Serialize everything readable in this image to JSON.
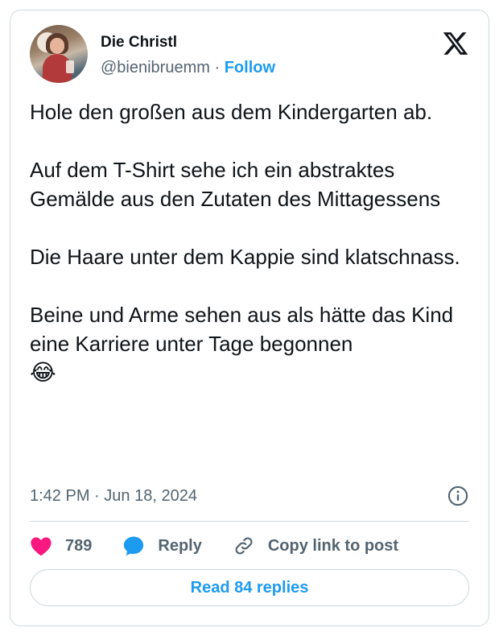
{
  "author": {
    "display_name": "Die Christl",
    "handle": "@bienibruemm",
    "separator": "·",
    "follow_label": "Follow"
  },
  "tweet": {
    "paragraphs": [
      "Hole den großen aus dem Kindergarten ab.",
      "Auf dem T-Shirt sehe ich ein abstraktes Gemälde aus den Zutaten des Mittagessens",
      "Die Haare unter dem Kappie sind klatschnass.",
      "Beine und Arme sehen aus als hätte das Kind eine Karriere unter Tage begonnen"
    ],
    "emoji": "😂",
    "time": "1:42 PM",
    "separator": "·",
    "date": "Jun 18, 2024"
  },
  "actions": {
    "like_count": "789",
    "reply_label": "Reply",
    "copy_link_label": "Copy link to post"
  },
  "read_replies_label": "Read 84 replies",
  "icons": {
    "brand": "x-logo-icon",
    "info": "info-icon",
    "like": "heart-icon",
    "reply": "speech-bubble-icon",
    "copy": "link-icon"
  },
  "colors": {
    "accent": "#1d9bf0",
    "like": "#f91880",
    "text": "#0f1419",
    "secondary": "#536471",
    "border": "#cfd9de"
  }
}
